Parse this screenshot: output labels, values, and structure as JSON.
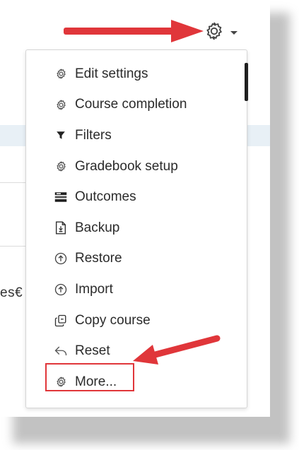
{
  "settings_toggle": {
    "icon": "gear-icon",
    "caret_icon": "caret-down-icon"
  },
  "menu": {
    "items": [
      {
        "label": "Edit settings",
        "icon": "gear-icon"
      },
      {
        "label": "Course completion",
        "icon": "gear-icon"
      },
      {
        "label": "Filters",
        "icon": "filter-icon"
      },
      {
        "label": "Gradebook setup",
        "icon": "gear-icon"
      },
      {
        "label": "Outcomes",
        "icon": "outcomes-icon"
      },
      {
        "label": "Backup",
        "icon": "backup-icon"
      },
      {
        "label": "Restore",
        "icon": "restore-icon"
      },
      {
        "label": "Import",
        "icon": "import-icon"
      },
      {
        "label": "Copy course",
        "icon": "copy-icon"
      },
      {
        "label": "Reset",
        "icon": "reset-icon"
      },
      {
        "label": "More...",
        "icon": "gear-icon"
      }
    ]
  },
  "background": {
    "partial_text": "es€"
  },
  "annotation_colors": {
    "arrow": "#e0363a",
    "highlight": "#e0363a"
  }
}
